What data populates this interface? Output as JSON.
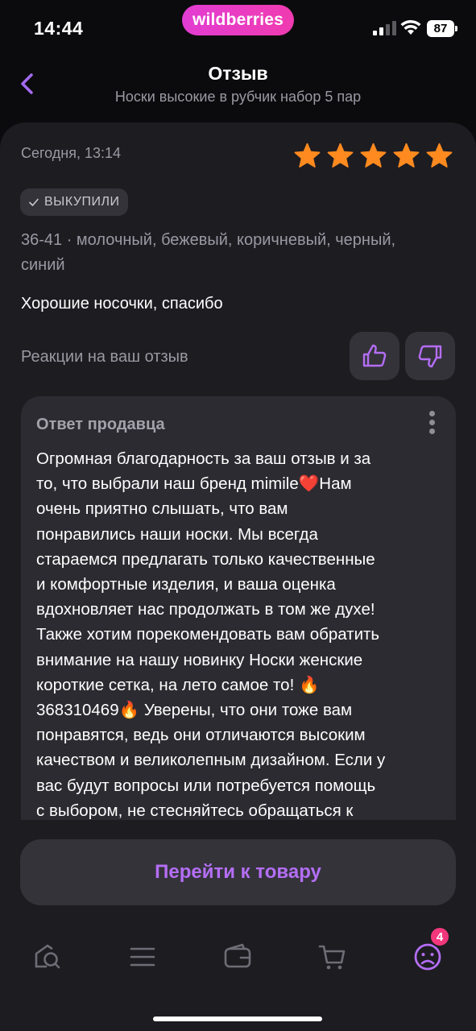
{
  "status_bar": {
    "time": "14:44",
    "brand": "wildberries",
    "battery": "87"
  },
  "header": {
    "title": "Отзыв",
    "subtitle": "Носки высокие в рубчик набор 5 пар",
    "back_icon": "chevron-left-icon"
  },
  "review": {
    "date": "Сегодня, 13:14",
    "rating": 5,
    "star_color": "#ff8a1f",
    "badge": "ВЫКУПИЛИ",
    "variant": "36-41 · молочный, бежевый, коричневый, черный, синий",
    "text": "Хорошие носочки, спасибо",
    "reactions_label": "Реакции на ваш отзыв"
  },
  "seller_reply": {
    "title": "Ответ продавца",
    "lines": [
      "Огромная благодарность за ваш отзыв и за",
      "то, что выбрали наш бренд mimile❤️Нам",
      "очень приятно слышать, что вам",
      "понравились наши носки. Мы всегда",
      "стараемся предлагать только качественные",
      "и комфортные изделия, и ваша оценка",
      "вдохновляет нас продолжать в том же духе!",
      "Также хотим порекомендовать вам обратить",
      "внимание на нашу новинку Носки женские",
      "короткие сетка, на лето самое то! 🔥",
      "368310469🔥 Уверены, что они тоже вам",
      "понравятся, ведь они отличаются высоким",
      "качеством и великолепным дизайном. Если у",
      "вас будут вопросы или потребуется помощь",
      "с выбором, не стесняйтесь обращаться к"
    ]
  },
  "cta": {
    "label": "Перейти к товару",
    "color": "#b46ef5"
  },
  "tabbar": {
    "items": [
      {
        "icon": "home-search-icon"
      },
      {
        "icon": "catalog-menu-icon"
      },
      {
        "icon": "wallet-icon"
      },
      {
        "icon": "cart-icon"
      },
      {
        "icon": "profile-icon",
        "badge": "4"
      }
    ]
  },
  "colors": {
    "accent": "#b46ef5",
    "badge": "#f2377c"
  }
}
